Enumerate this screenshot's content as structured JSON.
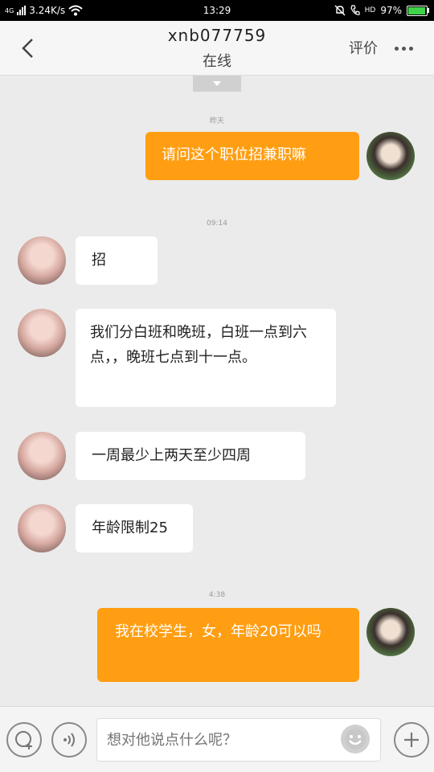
{
  "status_bar": {
    "network": "4G",
    "speed": "3.24K/s",
    "time": "13:29",
    "hd": "HD",
    "battery_text": "97%",
    "battery_level": 0.97
  },
  "header": {
    "title": "xnb077759",
    "subtitle": "在线",
    "rate_label": "评价"
  },
  "messages": [
    {
      "type": "time",
      "text": "昨天"
    },
    {
      "type": "out",
      "text": "请问这个职位招兼职嘛"
    },
    {
      "type": "time",
      "text": "09:14"
    },
    {
      "type": "in",
      "text": "招"
    },
    {
      "type": "in",
      "text": "我们分白班和晚班，白班一点到六点，，晚班七点到十一点。"
    },
    {
      "type": "in",
      "text": "一周最少上两天至少四周"
    },
    {
      "type": "in",
      "text": "年龄限制25"
    },
    {
      "type": "time",
      "text": "4:38"
    },
    {
      "type": "out",
      "text": "我在校学生，女，年龄20可以吗"
    }
  ],
  "input_bar": {
    "placeholder": "想对他说点什么呢？"
  },
  "colors": {
    "accent": "#ff9e12",
    "background": "#ebebeb",
    "bubble_in": "#ffffff"
  }
}
